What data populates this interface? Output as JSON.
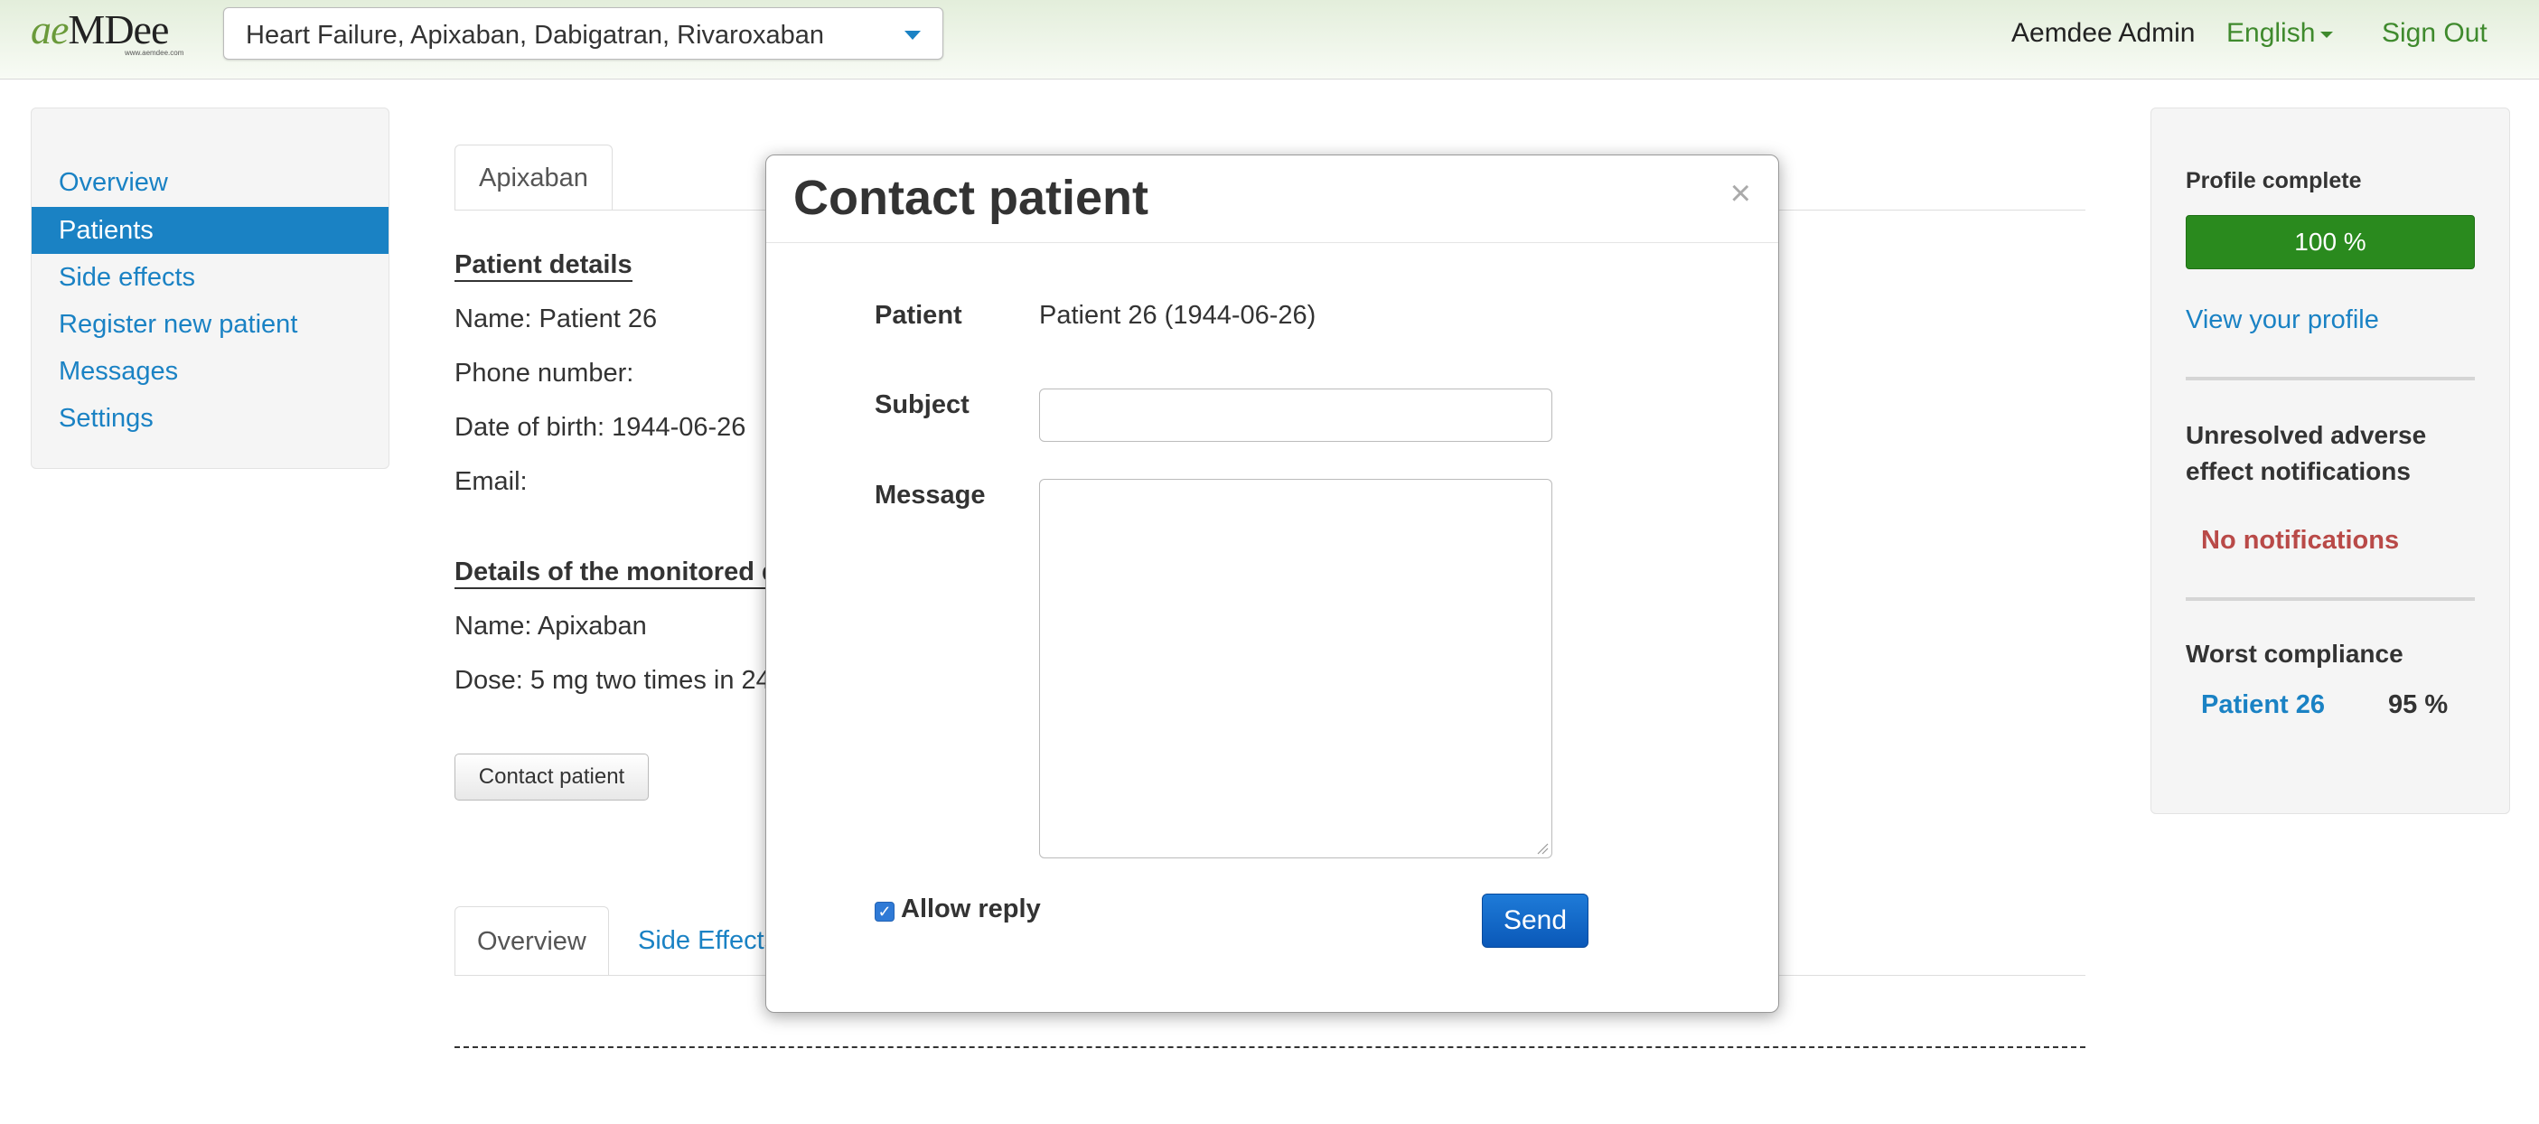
{
  "header": {
    "logo_text": "aeMDee",
    "logo_sub": "www.aemdee.com",
    "study_select": {
      "value": "Heart Failure, Apixaban, Dabigatran, Rivaroxaban"
    },
    "user_name": "Aemdee Admin",
    "language": "English",
    "sign_out": "Sign Out"
  },
  "sidebar": {
    "items": [
      {
        "label": "Overview",
        "active": false
      },
      {
        "label": "Patients",
        "active": true
      },
      {
        "label": "Side effects",
        "active": false
      },
      {
        "label": "Register new patient",
        "active": false
      },
      {
        "label": "Messages",
        "active": false
      },
      {
        "label": "Settings",
        "active": false
      }
    ]
  },
  "main": {
    "drug_tab": "Apixaban",
    "patient_details": {
      "heading": "Patient details",
      "name": "Name: Patient 26",
      "phone": "Phone number:",
      "dob": "Date of birth: 1944-06-26",
      "email": "Email:"
    },
    "drug_details": {
      "heading": "Details of the monitored d",
      "name": "Name: Apixaban",
      "dose": "Dose: 5 mg two times in 24"
    },
    "contact_button": "Contact patient",
    "bottom_tabs": [
      "Overview",
      "Side Effects"
    ]
  },
  "right_panel": {
    "profile_label": "Profile complete",
    "profile_progress": "100 %",
    "profile_percent": 100,
    "view_profile": "View your profile",
    "unresolved_heading": "Unresolved adverse effect notifications",
    "no_notifications": "No notifications",
    "worst_compliance_heading": "Worst compliance",
    "worst_compliance": {
      "patient": "Patient 26",
      "value": "95 %"
    }
  },
  "modal": {
    "title": "Contact patient",
    "close": "×",
    "patient_label": "Patient",
    "patient_value": "Patient 26 (1944-06-26)",
    "subject_label": "Subject",
    "subject_value": "",
    "message_label": "Message",
    "message_value": "",
    "allow_reply_label": "Allow reply",
    "allow_reply_checked": true,
    "send_label": "Send"
  },
  "colors": {
    "link": "#1a82c4",
    "brand_green": "#3f8a2d",
    "progress_green": "#2a8a1e",
    "warning_red": "#b94a48",
    "primary_button": "#0a58b8"
  }
}
